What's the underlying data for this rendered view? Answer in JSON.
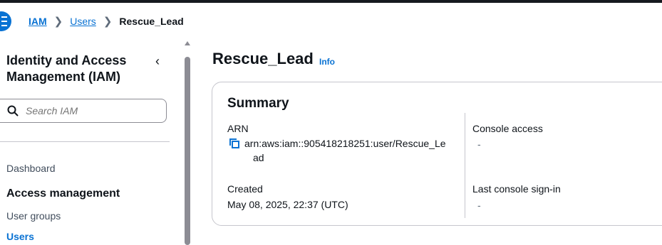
{
  "breadcrumb": {
    "items": [
      "IAM",
      "Users"
    ],
    "current": "Rescue_Lead"
  },
  "sidebar": {
    "title": "Identity and Access Management (IAM)",
    "search_placeholder": "Search IAM",
    "items": {
      "dashboard": "Dashboard",
      "section_access": "Access management",
      "user_groups": "User groups",
      "users": "Users"
    }
  },
  "main": {
    "title": "Rescue_Lead",
    "info_label": "Info",
    "summary": {
      "heading": "Summary",
      "arn_label": "ARN",
      "arn_value_line1": "arn:aws:iam::905418218251:user/Rescue_Le",
      "arn_value_line2": "ad",
      "created_label": "Created",
      "created_value": "May 08, 2025, 22:37 (UTC)",
      "console_access_label": "Console access",
      "console_access_value": "-",
      "last_signin_label": "Last console sign-in",
      "last_signin_value": "-"
    }
  },
  "colors": {
    "link": "#0972d3",
    "text": "#0f141a",
    "border": "#c6c6cd"
  }
}
